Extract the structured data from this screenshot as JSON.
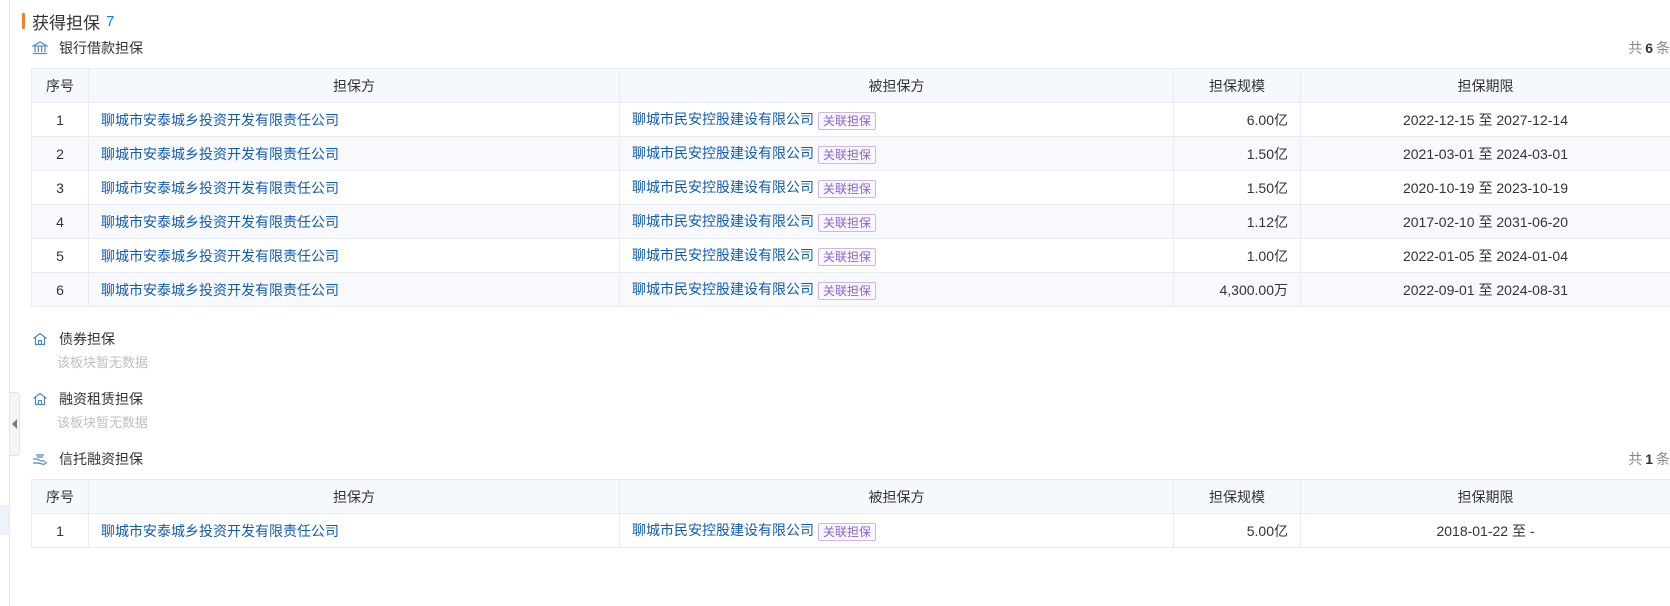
{
  "header": {
    "title": "获得担保",
    "count": "7"
  },
  "bank": {
    "title": "银行借款担保",
    "total": {
      "prefix": "共",
      "num": "6",
      "suffix": "条"
    },
    "columns": [
      "序号",
      "担保方",
      "被担保方",
      "担保规模",
      "担保期限"
    ],
    "rows": [
      {
        "idx": "1",
        "guarantor": "聊城市安泰城乡投资开发有限责任公司",
        "guaranteed": "聊城市民安控股建设有限公司",
        "tag": "关联担保",
        "scale": "6.00亿",
        "period": "2022-12-15 至 2027-12-14"
      },
      {
        "idx": "2",
        "guarantor": "聊城市安泰城乡投资开发有限责任公司",
        "guaranteed": "聊城市民安控股建设有限公司",
        "tag": "关联担保",
        "scale": "1.50亿",
        "period": "2021-03-01 至 2024-03-01"
      },
      {
        "idx": "3",
        "guarantor": "聊城市安泰城乡投资开发有限责任公司",
        "guaranteed": "聊城市民安控股建设有限公司",
        "tag": "关联担保",
        "scale": "1.50亿",
        "period": "2020-10-19 至 2023-10-19"
      },
      {
        "idx": "4",
        "guarantor": "聊城市安泰城乡投资开发有限责任公司",
        "guaranteed": "聊城市民安控股建设有限公司",
        "tag": "关联担保",
        "scale": "1.12亿",
        "period": "2017-02-10 至 2031-06-20"
      },
      {
        "idx": "5",
        "guarantor": "聊城市安泰城乡投资开发有限责任公司",
        "guaranteed": "聊城市民安控股建设有限公司",
        "tag": "关联担保",
        "scale": "1.00亿",
        "period": "2022-01-05 至 2024-01-04"
      },
      {
        "idx": "6",
        "guarantor": "聊城市安泰城乡投资开发有限责任公司",
        "guaranteed": "聊城市民安控股建设有限公司",
        "tag": "关联担保",
        "scale": "4,300.00万",
        "period": "2022-09-01 至 2024-08-31"
      }
    ]
  },
  "bond": {
    "title": "债券担保",
    "empty": "该板块暂无数据"
  },
  "lease": {
    "title": "融资租赁担保",
    "empty": "该板块暂无数据"
  },
  "trust": {
    "title": "信托融资担保",
    "total": {
      "prefix": "共",
      "num": "1",
      "suffix": "条"
    },
    "columns": [
      "序号",
      "担保方",
      "被担保方",
      "担保规模",
      "担保期限"
    ],
    "rows": [
      {
        "idx": "1",
        "guarantor": "聊城市安泰城乡投资开发有限责任公司",
        "guaranteed": "聊城市民安控股建设有限公司",
        "tag": "关联担保",
        "scale": "5.00亿",
        "period": "2018-01-22 至 -"
      }
    ]
  },
  "colors": {
    "accent": "#f37f2b",
    "link": "#0f5bbd",
    "count": "#0084ff",
    "tag": "#8a63d2"
  },
  "icons": {
    "bank": "bank-icon",
    "bond": "house-icon",
    "lease": "house-icon",
    "trust": "hand-coin-icon"
  }
}
